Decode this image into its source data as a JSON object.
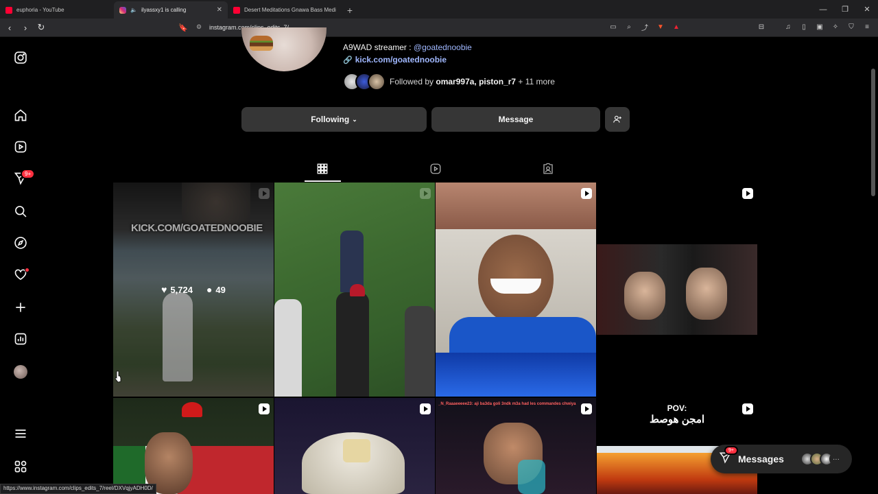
{
  "browser": {
    "tabs": [
      {
        "title": "euphoria - YouTube",
        "favicon": "youtube"
      },
      {
        "title": "ilyassxy1 is calling",
        "favicon": "instagram",
        "active": true
      },
      {
        "title": "Desert Meditations Gnawa Bass Medi",
        "favicon": "youtube"
      }
    ],
    "url": "instagram.com/clips_edits_7/",
    "status_url": "https://www.instagram.com/clips_edits_7/reel/DXVqjyADH0D/"
  },
  "leftnav": {
    "notifications_badge": "9+"
  },
  "profile": {
    "bio_line": "A9WAD streamer : ",
    "bio_mention": "@goatednoobie",
    "bio_link": "kick.com/goatednoobie",
    "followed_by_prefix": "Followed by ",
    "followed_by_names": "omar997a, piston_r7",
    "followed_by_suffix": " + 11 more",
    "following_label": "Following",
    "message_label": "Message"
  },
  "grid": {
    "hover_likes": "5,724",
    "hover_comments": "49",
    "overlay_text": "KICK.COM/GOATEDNOOBIE",
    "tile8_caption_1": "POV:",
    "tile8_caption_2": "امجن هوصط",
    "tile7_caption": "_N_Raaaeeeee23: aji ba3da goli 3ndk m3a had les commandes chwiya"
  },
  "messages": {
    "label": "Messages",
    "badge": "9+"
  },
  "colors": {
    "accent_link": "#a0b8ff",
    "badge_red": "#ff3040",
    "button_bg": "#363636"
  }
}
